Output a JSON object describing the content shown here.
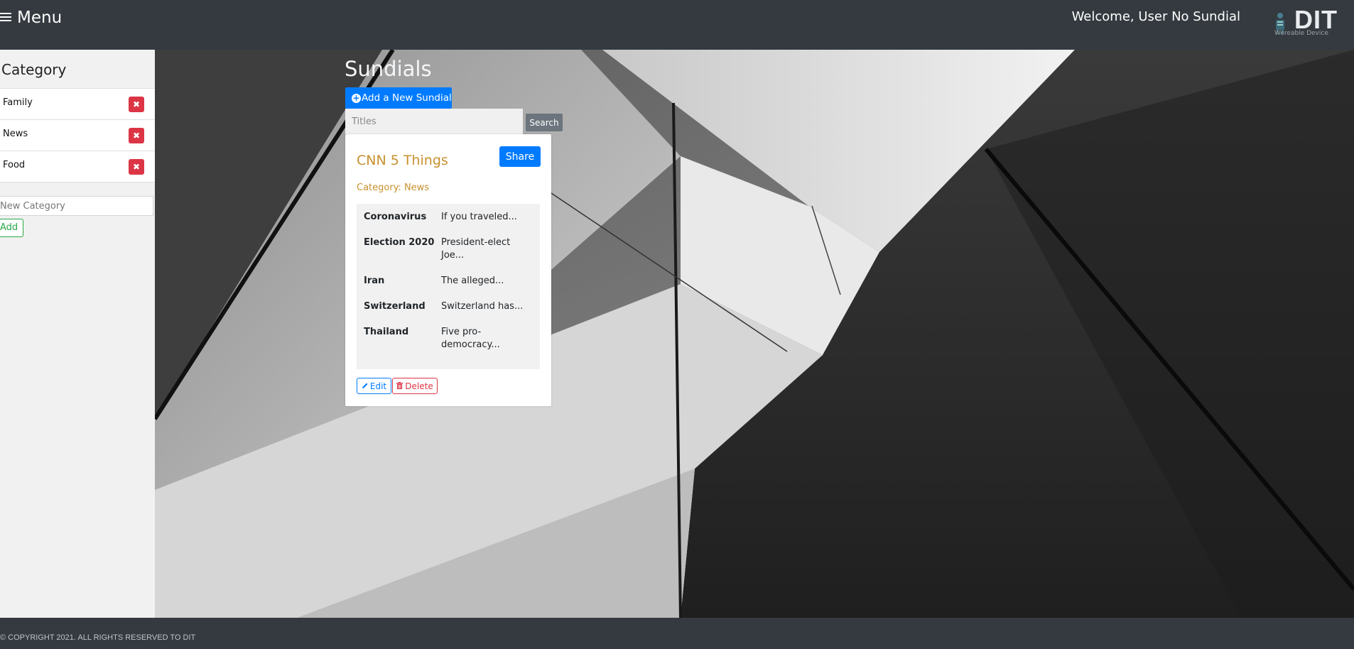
{
  "header": {
    "menu_label": "Menu",
    "welcome_text": "Welcome, User No Sundial",
    "logo_text": "DIT",
    "logo_subtitle": "Wereable Device"
  },
  "sidebar": {
    "title": "Category",
    "categories": [
      {
        "label": "Family"
      },
      {
        "label": "News"
      },
      {
        "label": "Food"
      }
    ],
    "new_category_placeholder": "New Category",
    "add_label": "Add"
  },
  "main": {
    "page_title": "Sundials",
    "add_button_label": "Add a New Sundial",
    "search_placeholder": "Titles",
    "search_button_label": "Search"
  },
  "card": {
    "title": "CNN 5 Things",
    "share_label": "Share",
    "category_text": "Category: News",
    "items": [
      {
        "key": "Coronavirus",
        "value": "If you traveled..."
      },
      {
        "key": "Election 2020",
        "value": "President-elect Joe..."
      },
      {
        "key": "Iran",
        "value": "The alleged..."
      },
      {
        "key": "Switzerland",
        "value": "Switzerland has..."
      },
      {
        "key": "Thailand",
        "value": "Five pro-democracy..."
      }
    ],
    "edit_label": "Edit",
    "delete_label": "Delete"
  },
  "footer": {
    "copyright": "© COPYRIGHT 2021. ALL RIGHTS RESERVED TO DIT"
  },
  "colors": {
    "topbar": "#343a40",
    "primary": "#007bff",
    "danger": "#dc3545",
    "success": "#28a745",
    "accent_title": "#c8902e",
    "sidebar_bg": "#f1f1f1"
  }
}
